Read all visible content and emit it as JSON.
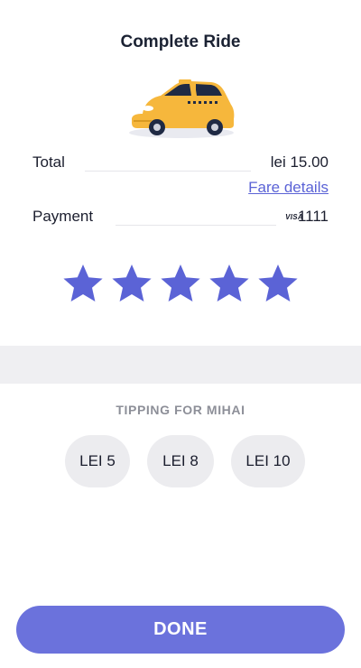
{
  "header": {
    "title": "Complete Ride"
  },
  "ride": {
    "total_label": "Total",
    "total_value": "lei 15.00",
    "fare_details_link": "Fare details",
    "payment_label": "Payment",
    "card_brand": "VISA",
    "card_last4": "1111"
  },
  "rating": {
    "max": 5,
    "value": 5,
    "star_color": "#5b63d6"
  },
  "tipping": {
    "title": "TIPPING FOR MIHAI",
    "options": [
      "LEI 5",
      "LEI 8",
      "LEI 10"
    ]
  },
  "actions": {
    "done_label": "DONE"
  },
  "colors": {
    "accent": "#5b63d6",
    "button": "#6b72dc",
    "taxi_yellow": "#f6b73c"
  },
  "icons": {
    "car": "taxi-car-illustration",
    "star": "star-icon"
  }
}
